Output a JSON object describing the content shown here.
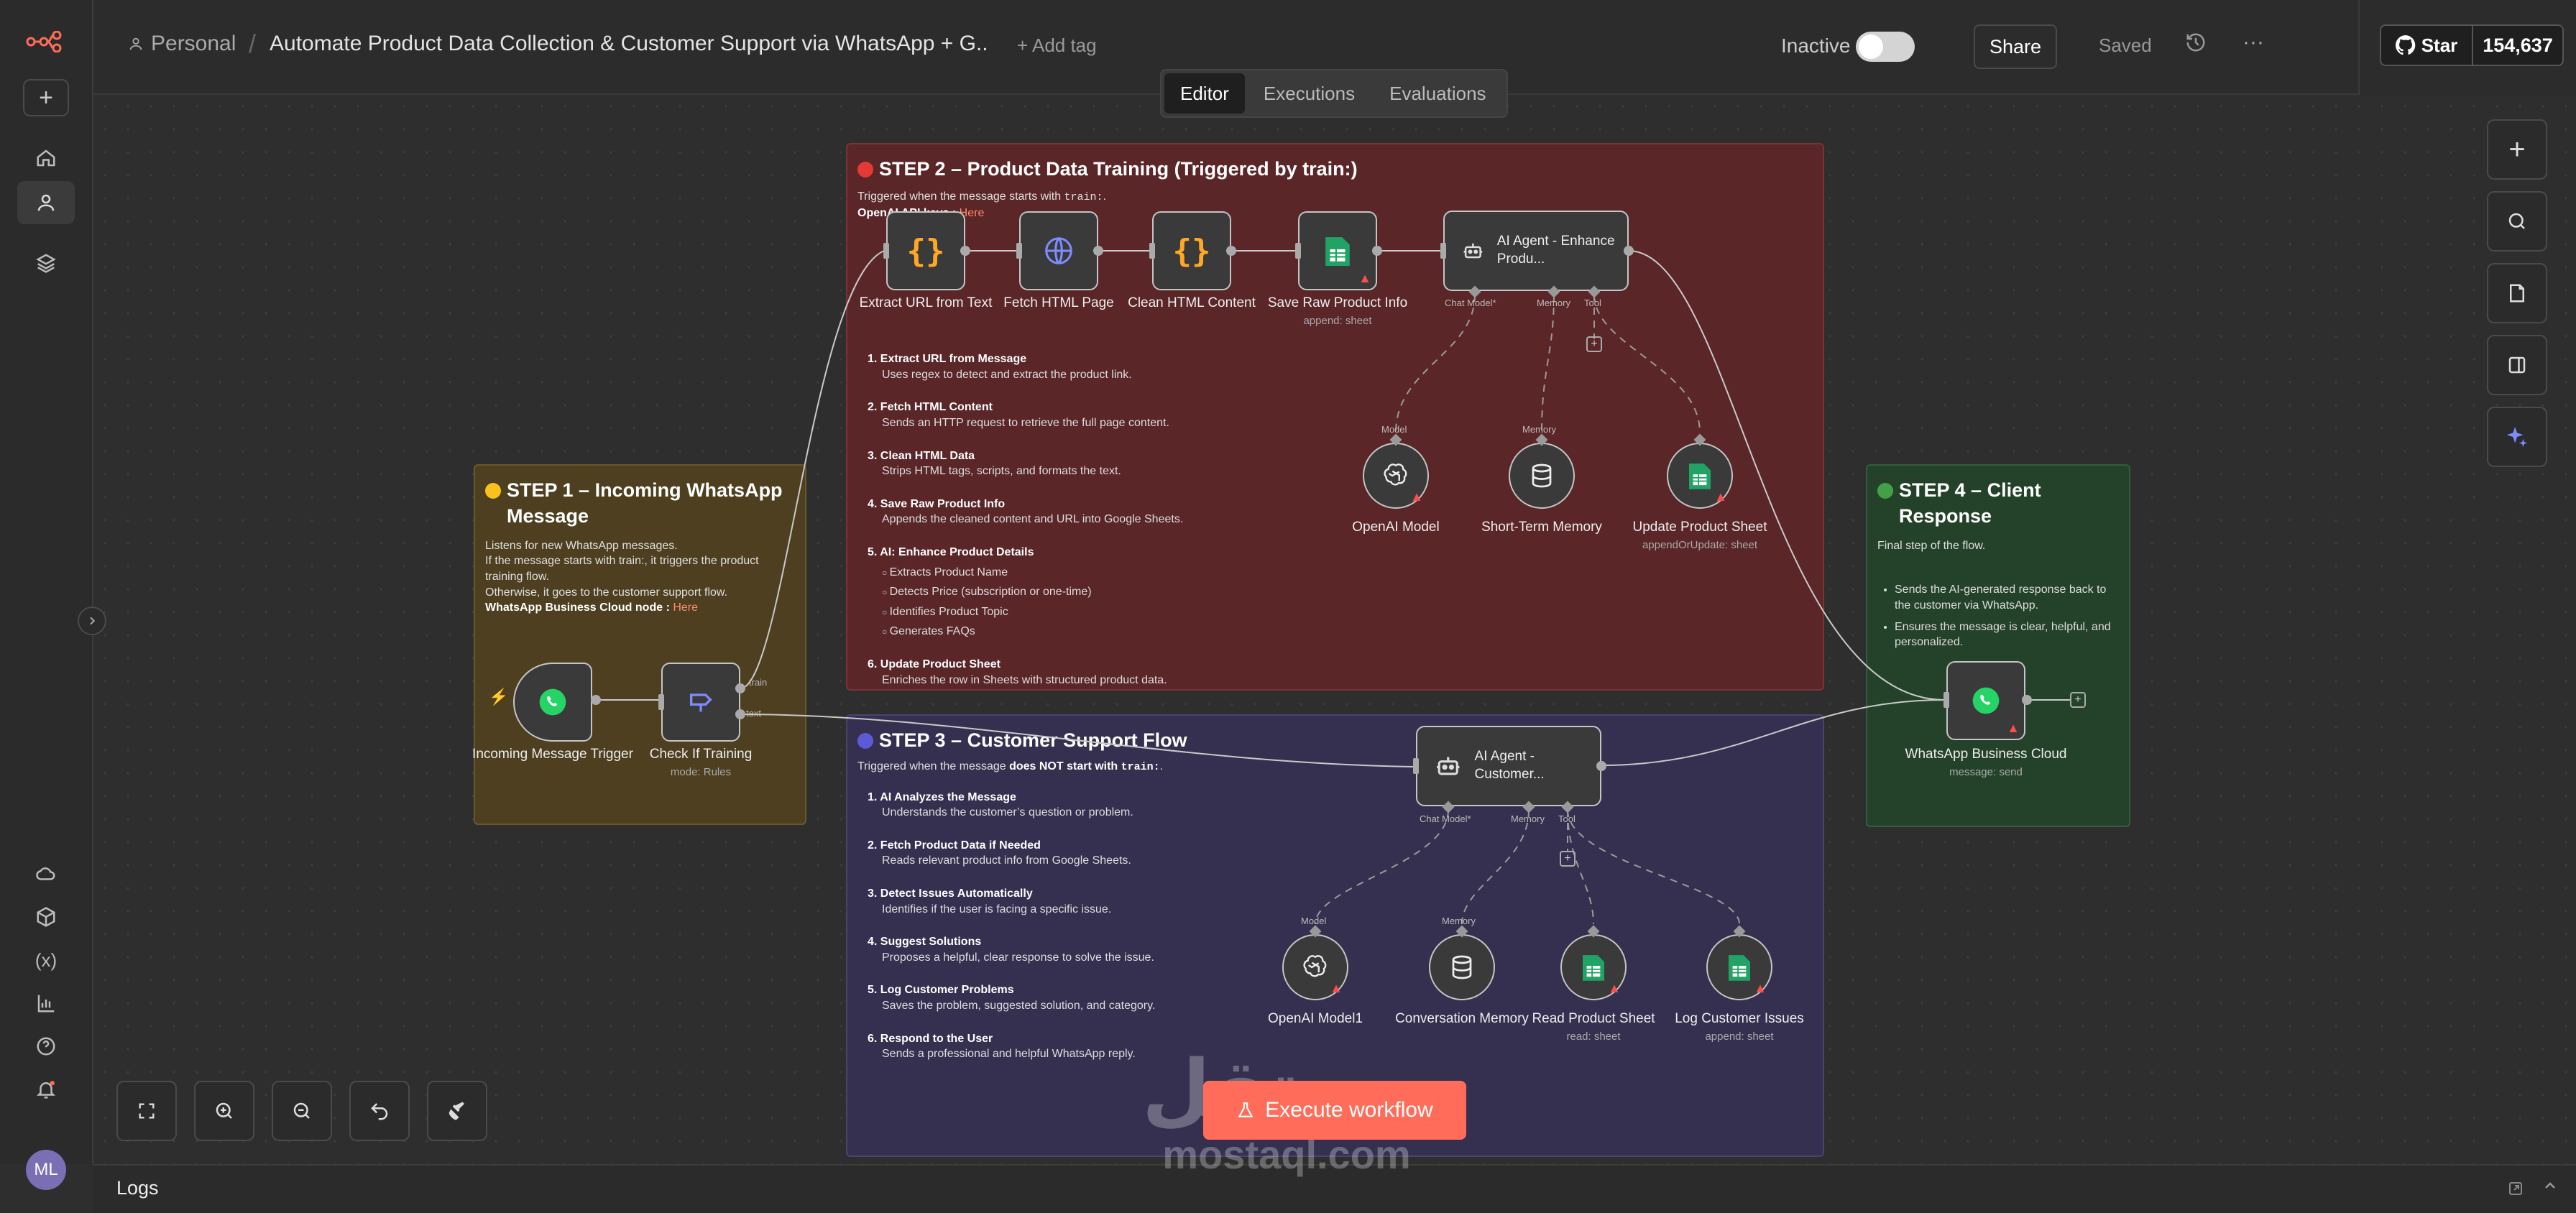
{
  "header": {
    "project": "Personal",
    "workflow_title": "Automate Product Data Collection & Customer Support via WhatsApp + G...",
    "add_tag": "+ Add tag",
    "status_label": "Inactive",
    "share": "Share",
    "saved": "Saved",
    "github_star": "Star",
    "github_count": "154,637"
  },
  "tabs": [
    "Editor",
    "Executions",
    "Evaluations"
  ],
  "sidebar": {
    "avatar_initials": "ML",
    "items": [
      "add",
      "home",
      "personal",
      "projects",
      "templates",
      "insights",
      "variables",
      "analytics",
      "help",
      "notifications"
    ]
  },
  "stickies": {
    "step1": {
      "title": "STEP 1 – Incoming WhatsApp Message",
      "line1": "Listens for new WhatsApp messages.",
      "line2": "If the message starts with train:, it triggers the product training flow.",
      "line3": "Otherwise, it goes to the customer support flow.",
      "link_label": "WhatsApp Business Cloud node : ",
      "link": "Here"
    },
    "step2": {
      "title": "STEP 2 – Product Data Training (Triggered by train:)",
      "trig_pre": "Triggered when the message starts with ",
      "trig_code": "train:",
      "trig_post": ".",
      "api_label": "OpenAI API keys : ",
      "api_link": "Here",
      "steps": [
        {
          "h": "1. Extract URL from Message",
          "d": "Uses regex to detect and extract the product link."
        },
        {
          "h": "2. Fetch HTML Content",
          "d": "Sends an HTTP request to retrieve the full page content."
        },
        {
          "h": "3. Clean HTML Data",
          "d": "Strips HTML tags, scripts, and formats the text."
        },
        {
          "h": "4. Save Raw Product Info",
          "d": "Appends the cleaned content and URL into Google Sheets."
        },
        {
          "h": "5. AI: Enhance Product Details",
          "d": ""
        },
        {
          "h": "6. Update Product Sheet",
          "d": "Enriches the row in Sheets with structured product data."
        }
      ],
      "ai_bullets": [
        "Extracts Product Name",
        "Detects Price (subscription or one-time)",
        "Identifies Product Topic",
        "Generates FAQs"
      ]
    },
    "step3": {
      "title": "STEP 3 – Customer Support Flow",
      "trig_pre": "Triggered when the message ",
      "trig_bold": "does NOT start with ",
      "trig_code": "train:",
      "trig_post": ".",
      "steps": [
        {
          "h": "1. AI Analyzes the Message",
          "d": "Understands the customer’s question or problem."
        },
        {
          "h": "2. Fetch Product Data if Needed",
          "d": "Reads relevant product info from Google Sheets."
        },
        {
          "h": "3. Detect Issues Automatically",
          "d": "Identifies if the user is facing a specific issue."
        },
        {
          "h": "4. Suggest Solutions",
          "d": "Proposes a helpful, clear response to solve the issue."
        },
        {
          "h": "5. Log Customer Problems",
          "d": "Saves the problem, suggested solution, and category."
        },
        {
          "h": "6. Respond to the User",
          "d": "Sends a professional and helpful WhatsApp reply."
        }
      ]
    },
    "step4": {
      "title": "STEP 4 – Client Response",
      "desc": "Final step of the flow.",
      "bullets": [
        "Sends the AI-generated response back to the customer via WhatsApp.",
        "Ensures the message is clear, helpful, and personalized."
      ]
    }
  },
  "nodes": {
    "incoming": {
      "label": "Incoming Message Trigger"
    },
    "check": {
      "label": "Check If Training",
      "sub": "mode: Rules",
      "out_train": "train",
      "out_text": "text"
    },
    "extract": {
      "label": "Extract URL from Text"
    },
    "fetch": {
      "label": "Fetch HTML Page"
    },
    "clean": {
      "label": "Clean HTML Content"
    },
    "save": {
      "label": "Save Raw Product Info",
      "sub": "append: sheet"
    },
    "agent1": {
      "label": "AI Agent - Enhance Produ..."
    },
    "openai": {
      "label": "OpenAI Model"
    },
    "memory": {
      "label": "Short-Term Memory"
    },
    "update": {
      "label": "Update Product Sheet",
      "sub": "appendOrUpdate: sheet"
    },
    "agent2": {
      "label": "AI Agent - Customer..."
    },
    "openai1": {
      "label": "OpenAI Model1"
    },
    "convmem": {
      "label": "Conversation Memory"
    },
    "readsheet": {
      "label": "Read Product Sheet",
      "sub": "read: sheet"
    },
    "logissues": {
      "label": "Log Customer Issues",
      "sub": "append: sheet"
    },
    "wa_send": {
      "label": "WhatsApp Business Cloud",
      "sub": "message: send"
    }
  },
  "ports": {
    "chat_model": "Chat Model*",
    "memory": "Memory",
    "tool": "Tool",
    "model": "Model"
  },
  "execute": "Execute workflow",
  "logs": "Logs",
  "watermark": {
    "arabic": "مستقل",
    "latin": "mostaql.com"
  },
  "colors": {
    "accent": "#ff6d5a",
    "step1": "#4d3f1f",
    "step2": "#5a2628",
    "step3": "#35304f",
    "step4": "#24422a"
  }
}
